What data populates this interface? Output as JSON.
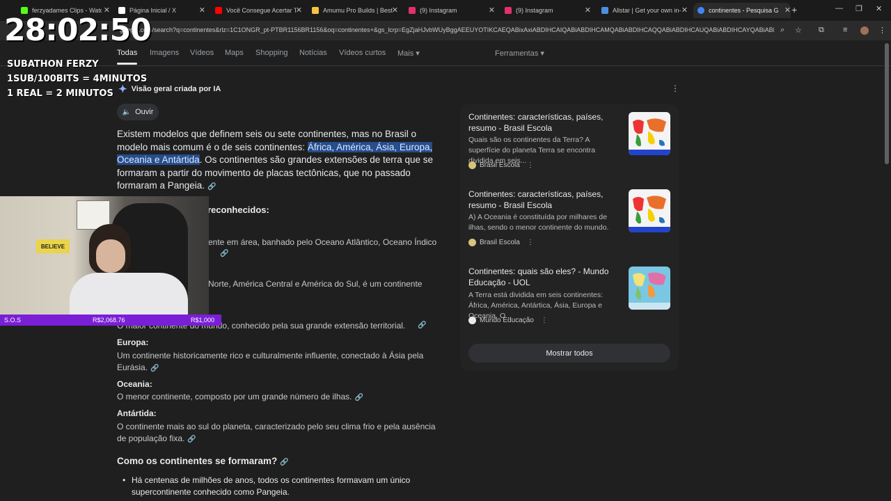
{
  "tabs": [
    {
      "title": "ferzyadames Clips - Watc",
      "color": "#53fc18"
    },
    {
      "title": "Página Inicial / X",
      "color": "#ffffff"
    },
    {
      "title": "Você Consegue Acertar To",
      "color": "#ff0000"
    },
    {
      "title": "Amumu Pro Builds | Best",
      "color": "#f6c342"
    },
    {
      "title": "(9) Instagram",
      "color": "#e1306c"
    },
    {
      "title": "(9) Instagram",
      "color": "#e1306c"
    },
    {
      "title": "Allstar | Get your own in-",
      "color": "#4a90e2"
    },
    {
      "title": "continentes - Pesquisa G",
      "color": "#4285f4"
    }
  ],
  "address": {
    "url": "google.com/search?q=continentes&rlz=1C1ONGR_pt-PTBR1156BR1156&oq=continentes+&gs_lcrp=EgZjaHJvbWUyBggAEEUYOTIKCAEQABixAxiABDIHCAIQABiABDIHCAMQABiABDIHCAQQABiABDIHCAUQABiABDIHCAYQABiABDIHCAcQ..."
  },
  "search_nav": {
    "items": [
      "Todas",
      "Imagens",
      "Vídeos",
      "Maps",
      "Shopping",
      "Notícias",
      "Vídeos curtos",
      "Mais ▾"
    ],
    "tools": "Ferramentas ▾"
  },
  "overlay": {
    "timer": "28:02:50",
    "line1": "SUBATHON FERZY",
    "line2": "1SUB/100BITS = 4MINUTOS",
    "line3": "1 REAL = 2 MINUTOS",
    "sign": "BELIEVE",
    "donation_left": "S.O.S",
    "donation_mid": "R$2,068.76",
    "donation_right": "R$1,000"
  },
  "ai": {
    "header": "Visão geral criada por IA",
    "listen": "Ouvir",
    "intro_a": "Existem modelos que definem seis ou sete continentes, mas no Brasil o modelo mais comum é o de seis continentes: ",
    "intro_hl": "África, América, Ásia, Europa, Oceania e Antártida",
    "intro_b": ". Os continentes são grandes extensões de terra que se formaram a partir do movimento de placas tectônicas, que no passado formaram a Pangeia.",
    "recognized": "reconhecidos:",
    "africa_txt": "ente em área, banhado pelo Oceano Atlântico, Oceano Índico",
    "america_txt": "Norte, América Central e América do Sul, é um continente",
    "asia_txt": "O maior continente do mundo, conhecido pela sua grande extensão territorial.",
    "europa_h": "Europa:",
    "europa_txt": "Um continente historicamente rico e culturalmente influente, conectado à Ásia pela Eurásia.",
    "oceania_h": "Oceania:",
    "oceania_txt": "O menor continente, composto por um grande número de ilhas.",
    "antartida_h": "Antártida:",
    "antartida_txt": "O continente mais ao sul do planeta, caracterizado pelo seu clima frio e pela ausência de população fixa.",
    "how_h": "Como os continentes se formaram?",
    "bullet1": "Há centenas de milhões de anos, todos os continentes formavam um único supercontinente conhecido como Pangeia."
  },
  "sources": [
    {
      "title": "Continentes: características, países, resumo - Brasil Escola",
      "desc": "Quais são os continentes da Terra? A superfície do planeta Terra se encontra dividida em seis...",
      "site": "Brasil Escola"
    },
    {
      "title": "Continentes: características, países, resumo - Brasil Escola",
      "desc": "A) A Oceania é constituída por milhares de ilhas, sendo o menor continente do mundo.",
      "site": "Brasil Escola"
    },
    {
      "title": "Continentes: quais são eles? - Mundo Educação - UOL",
      "desc": "A Terra está dividida em seis continentes: África, América, Antártica, Ásia, Europa e Oceania. O...",
      "site": "Mundo Educação"
    }
  ],
  "show_all": "Mostrar todos"
}
